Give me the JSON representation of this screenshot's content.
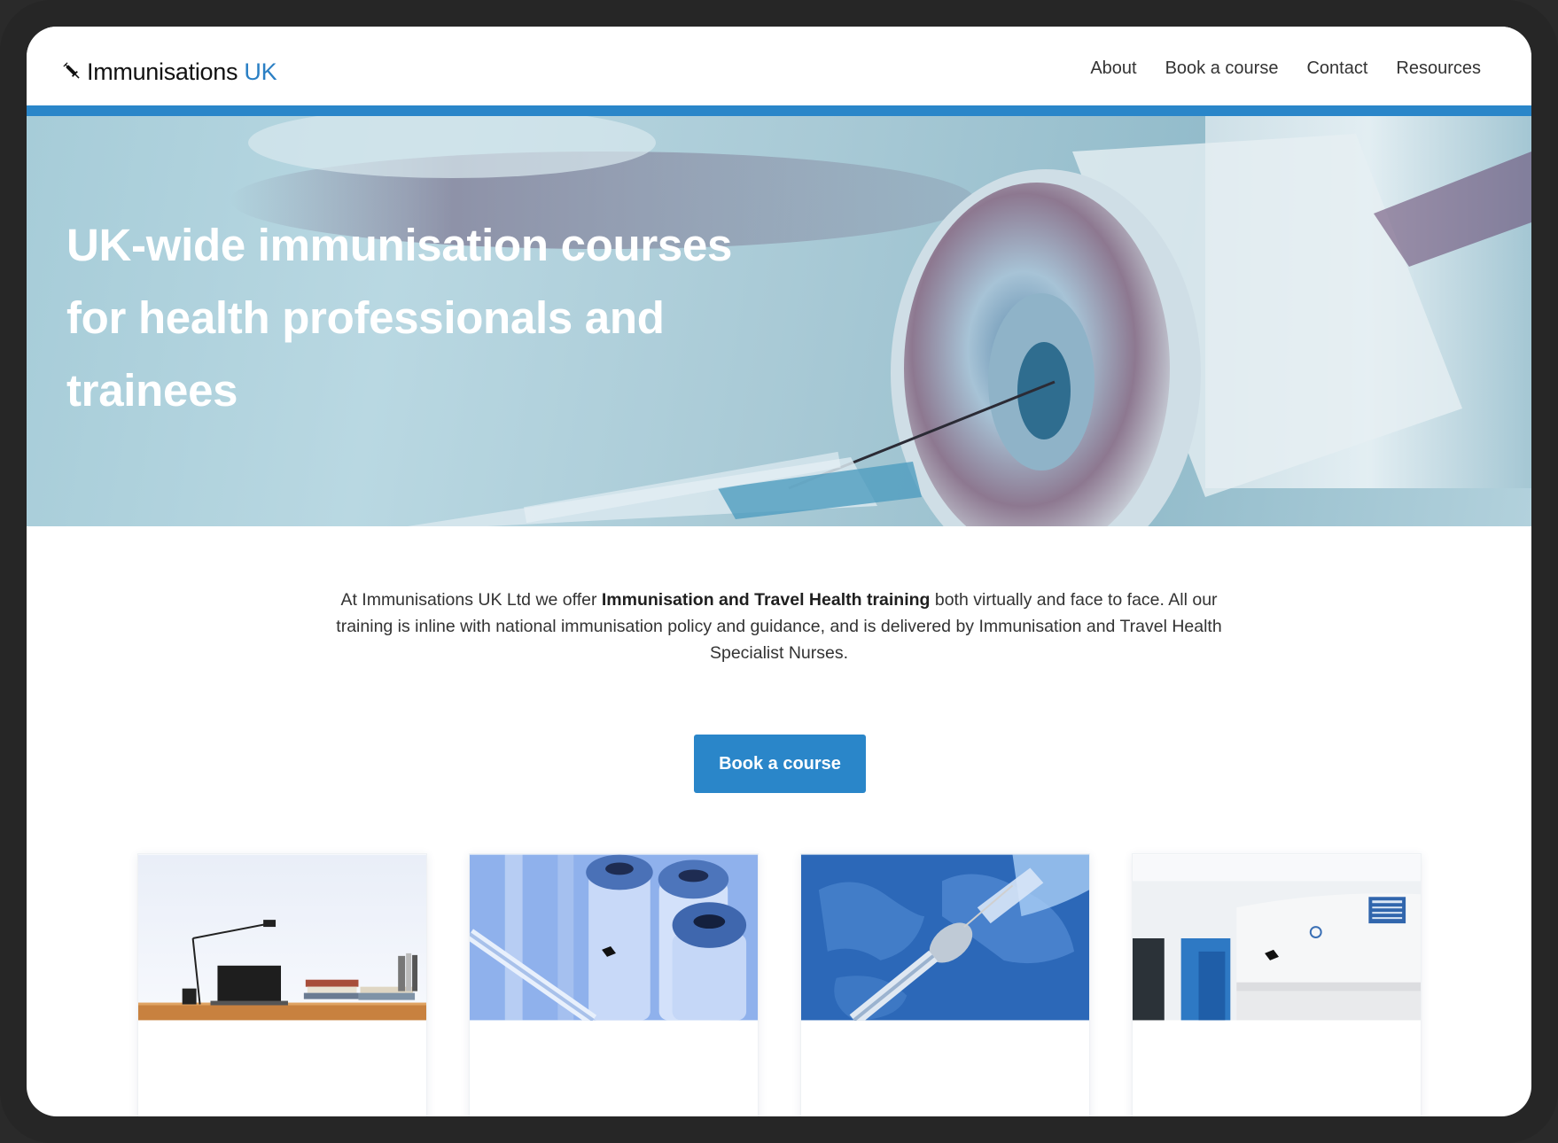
{
  "brand": {
    "name": "Immunisations",
    "accent": "UK",
    "icon": "syringe-icon"
  },
  "nav": {
    "items": [
      "About",
      "Book a course",
      "Contact",
      "Resources"
    ]
  },
  "hero": {
    "title": "UK-wide immunisation courses for health professionals and trainees"
  },
  "intro": {
    "before": "At Immunisations UK Ltd we offer ",
    "bold": "Immunisation and Travel Health training",
    "after": " both virtually and face to face. All our training is inline with national immunisation policy and guidance, and is delivered by Immunisation and Travel Health Specialist Nurses."
  },
  "cta": {
    "label": "Book a course"
  },
  "cards": [
    {
      "image": "desk-laptop-image"
    },
    {
      "image": "vaccine-vials-image"
    },
    {
      "image": "world-map-syringe-image"
    },
    {
      "image": "clinic-reception-image"
    }
  ],
  "colors": {
    "accent": "#2a86c9",
    "brand_accent": "#2a7fc4",
    "frame": "#262626",
    "text": "#333333"
  }
}
